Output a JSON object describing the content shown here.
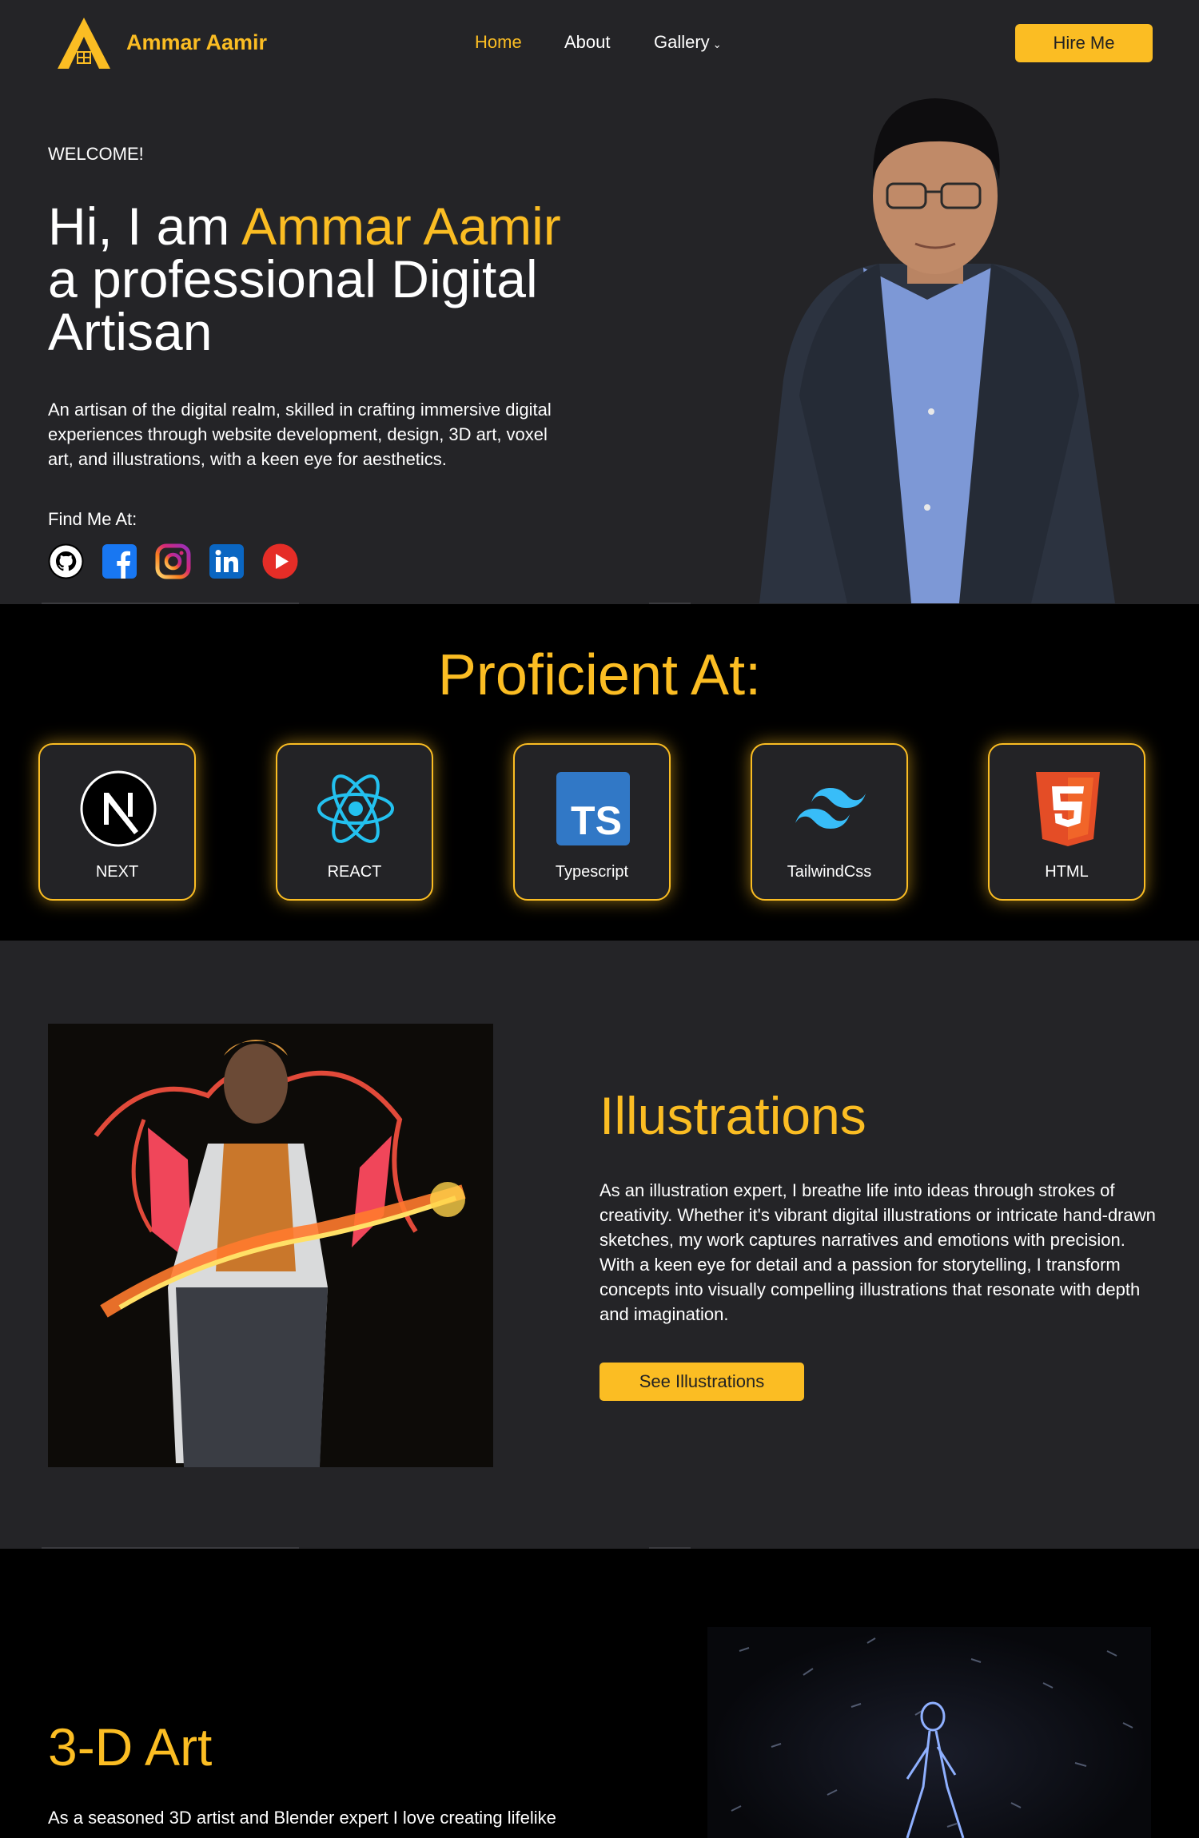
{
  "nav": {
    "brand": "Ammar Aamir",
    "links": [
      {
        "label": "Home"
      },
      {
        "label": "About"
      },
      {
        "label": "Gallery"
      }
    ],
    "gallery_chevron": "⌄",
    "hire_label": "Hire Me"
  },
  "hero": {
    "welcome": "WELCOME!",
    "title_prefix": "Hi, I am ",
    "title_name": "Ammar Aamir",
    "title_rest": "a professional Digital Artisan",
    "description": "An artisan of the digital realm, skilled in crafting immersive digital experiences through website development, design, 3D art, voxel art, and illustrations, with a keen eye for aesthetics.",
    "find_label": "Find Me At:",
    "socials": [
      {
        "icon": "github-icon"
      },
      {
        "icon": "facebook-icon"
      },
      {
        "icon": "instagram-icon"
      },
      {
        "icon": "linkedin-icon"
      },
      {
        "icon": "youtube-icon"
      }
    ]
  },
  "proficient": {
    "title": "Proficient At:",
    "skills": [
      {
        "label": "NEXT",
        "icon": "nextjs-icon"
      },
      {
        "label": "REACT",
        "icon": "react-icon"
      },
      {
        "label": "Typescript",
        "icon": "typescript-icon"
      },
      {
        "label": "TailwindCss",
        "icon": "tailwind-icon"
      },
      {
        "label": "HTML",
        "icon": "html5-icon"
      }
    ]
  },
  "illustrations": {
    "title": "Illustrations",
    "description": "As an illustration expert, I breathe life into ideas through strokes of creativity. Whether it's vibrant digital illustrations or intricate hand-drawn sketches, my work captures narratives and emotions with precision. With a keen eye for detail and a passion for storytelling, I transform concepts into visually compelling illustrations that resonate with depth and imagination.",
    "button_label": "See Illustrations"
  },
  "three_d": {
    "title": "3-D Art",
    "description": "As a seasoned 3D artist and Blender expert I love creating lifelike"
  },
  "colors": {
    "accent": "#fbbd23",
    "background": "#242427",
    "section_dark": "#000000"
  }
}
